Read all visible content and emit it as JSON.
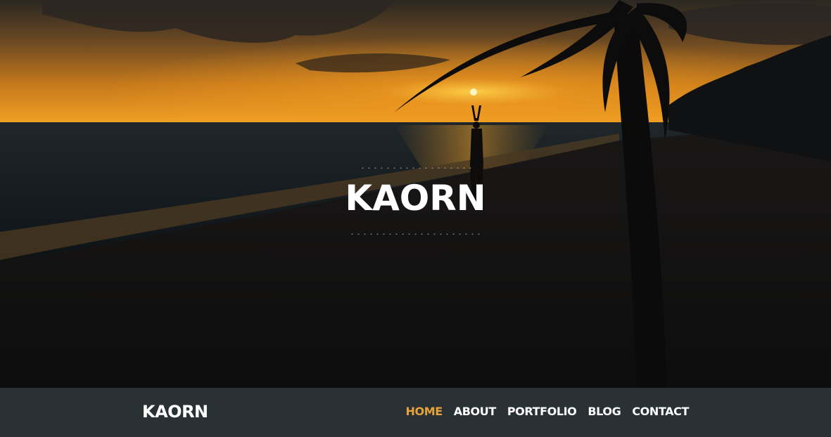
{
  "hero": {
    "title": "KAORN"
  },
  "navbar": {
    "brand": "KAORN",
    "items": [
      {
        "label": "HOME",
        "active": true
      },
      {
        "label": "ABOUT",
        "active": false
      },
      {
        "label": "PORTFOLIO",
        "active": false
      },
      {
        "label": "BLOG",
        "active": false
      },
      {
        "label": "CONTACT",
        "active": false
      }
    ]
  },
  "colors": {
    "nav_bg": "#2a3134",
    "accent": "#e8a23a",
    "text": "#ffffff"
  }
}
